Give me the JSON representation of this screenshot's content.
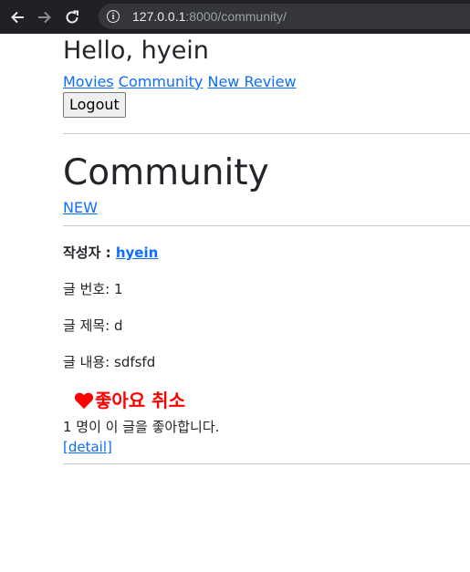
{
  "browser": {
    "url_host": "127.0.0.1",
    "url_path": ":8000/community/"
  },
  "header": {
    "greeting": "Hello, hyein",
    "nav": {
      "movies": "Movies",
      "community": "Community",
      "new_review": "New Review"
    },
    "logout_label": "Logout"
  },
  "main": {
    "title": "Community",
    "new_link": "NEW",
    "posts": [
      {
        "author_label": "작성자 : ",
        "author": "hyein",
        "number_label": "글 번호: ",
        "number": "1",
        "title_label": "글 제목: ",
        "title": "d",
        "content_label": "글 내용: ",
        "content": "sdfsfd",
        "like_button": "좋아요 취소",
        "like_count_text": "1 명이 이 글을 좋아합니다.",
        "detail_link": "[detail]"
      }
    ]
  },
  "colors": {
    "link": "#0d6efd",
    "like": "#ff0000",
    "chrome": "#202124"
  }
}
